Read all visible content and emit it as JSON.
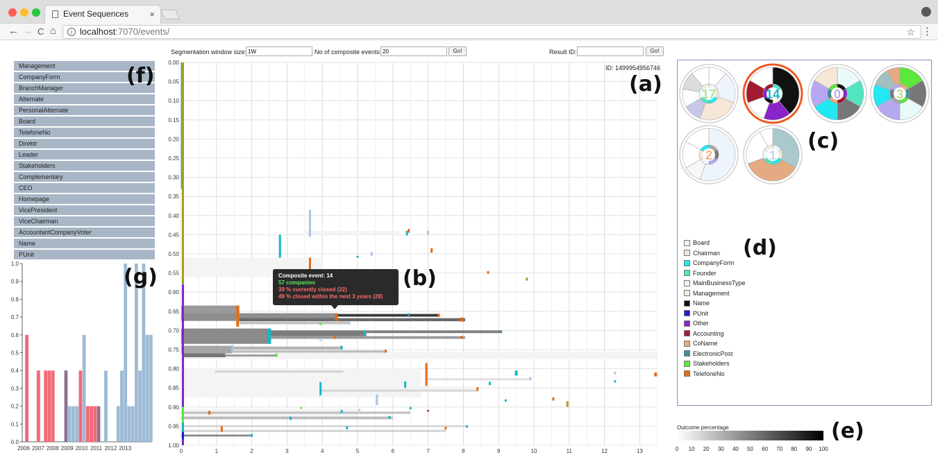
{
  "browser": {
    "tab_title": "Event Sequences",
    "tab_close": "×",
    "url": "localhost:7070/events/",
    "url_host": "localhost",
    "url_path": ":7070/events/",
    "nav_back": "←",
    "nav_forward": "→",
    "nav_reload": "C",
    "nav_home": "⌂",
    "info_glyph": "i",
    "star_glyph": "☆",
    "menu_glyph": "⋮"
  },
  "controls": {
    "window_label": "Segmentation window size:",
    "window_value": "1W",
    "composite_label": "No of composite events:",
    "composite_value": "20",
    "go_label": "Go!",
    "result_label": "Result ID:",
    "result_value": "",
    "result_go_label": "Go!"
  },
  "attributes": [
    "Management",
    "CompanyForm",
    "BranchManager",
    "Alternate",
    "PersonalAlternate",
    "Board",
    "TelefoneNo",
    "Direktr",
    "Leader",
    "Stakeholders",
    "Complementary",
    "CEO",
    "Homepage",
    "VicePresident",
    "ViceChairman",
    "AccountantCompanyVoter",
    "Name",
    "PUnit"
  ],
  "panel_labels": {
    "a": "(a)",
    "b": "(b)",
    "c": "(c)",
    "d": "(d)",
    "e": "(e)",
    "f": "(f)",
    "g": "(g)"
  },
  "main_chart": {
    "id_label": "ID: 1499954956746",
    "y_ticks": [
      "0.00",
      "0.05",
      "0.10",
      "0.15",
      "0.20",
      "0.25",
      "0.30",
      "0.35",
      "0.40",
      "0.45",
      "0.50",
      "0.55",
      "0.60",
      "0.65",
      "0.70",
      "0.75",
      "0.80",
      "0.85",
      "0.90",
      "0.95",
      "1.00"
    ],
    "x_ticks": [
      "0",
      "1",
      "2",
      "3",
      "4",
      "5",
      "6",
      "7",
      "8",
      "9",
      "10",
      "11",
      "12",
      "13"
    ]
  },
  "tooltip": {
    "title": "Composite event: 14",
    "companies": "57 companies",
    "closed": "39 % currently closed (22)",
    "within": "49 % closed within the next 3 years (28)"
  },
  "glyphs": [
    {
      "label": "17",
      "selected": false,
      "color": "#a7e5a2"
    },
    {
      "label": "14",
      "selected": true,
      "color": "#18b9c9"
    },
    {
      "label": "0",
      "selected": false,
      "color": "#c4a9e6"
    },
    {
      "label": "3",
      "selected": false,
      "color": "#c7dc8d"
    },
    {
      "label": "2",
      "selected": false,
      "color": "#f2b684"
    },
    {
      "label": "1",
      "selected": false,
      "color": "#c9d4e8"
    }
  ],
  "legend": [
    {
      "label": "Board",
      "color": "#eef4fb"
    },
    {
      "label": "Chairman",
      "color": "#f6e6d6"
    },
    {
      "label": "CompanyForm",
      "color": "#21e8f3"
    },
    {
      "label": "Founder",
      "color": "#52e5c0"
    },
    {
      "label": "MainBusinessType",
      "color": "#e9fafa"
    },
    {
      "label": "Management",
      "color": "#f0eedd"
    },
    {
      "label": "Name",
      "color": "#111111"
    },
    {
      "label": "PUnit",
      "color": "#1b1bd8"
    },
    {
      "label": "Other",
      "color": "#8a23c9"
    },
    {
      "label": "Accounting",
      "color": "#a3192f"
    },
    {
      "label": "CoName",
      "color": "#e3aa83"
    },
    {
      "label": "ElectronicPost",
      "color": "#3f8f98"
    },
    {
      "label": "Stakeholders",
      "color": "#5ce83a"
    },
    {
      "label": "TelefoneNo",
      "color": "#e86a14"
    }
  ],
  "outcome": {
    "title": "Outcome percentage",
    "ticks": [
      "0",
      "10",
      "20",
      "30",
      "40",
      "50",
      "60",
      "70",
      "80",
      "90",
      "100"
    ]
  },
  "chart_data": {
    "type": "bar",
    "categories": [
      "2006",
      "2007",
      "2008",
      "2009",
      "2010",
      "2011",
      "2012",
      "2013"
    ],
    "y_ticks": [
      "0.0",
      "0.1",
      "0.2",
      "0.3",
      "0.4",
      "0.5",
      "0.6",
      "0.7",
      "0.8",
      "0.9",
      "1.0"
    ],
    "ylim": [
      0,
      1
    ],
    "bars": [
      {
        "pos": 0.2,
        "value": 0.6,
        "color": "#f26a78"
      },
      {
        "pos": 1.0,
        "value": 0.4,
        "color": "#f26a78"
      },
      {
        "pos": 1.5,
        "value": 0.4,
        "color": "#f26a78"
      },
      {
        "pos": 1.75,
        "value": 0.4,
        "color": "#f26a78"
      },
      {
        "pos": 2.0,
        "value": 0.4,
        "color": "#f26a78"
      },
      {
        "pos": 2.9,
        "value": 0.4,
        "color": "#8e708f"
      },
      {
        "pos": 3.15,
        "value": 0.2,
        "color": "#9dbad6"
      },
      {
        "pos": 3.4,
        "value": 0.2,
        "color": "#9dbad6"
      },
      {
        "pos": 3.65,
        "value": 0.2,
        "color": "#9dbad6"
      },
      {
        "pos": 3.9,
        "value": 0.4,
        "color": "#f26a78"
      },
      {
        "pos": 4.15,
        "value": 0.6,
        "color": "#9dbad6"
      },
      {
        "pos": 4.4,
        "value": 0.2,
        "color": "#f26a78"
      },
      {
        "pos": 4.65,
        "value": 0.2,
        "color": "#f26a78"
      },
      {
        "pos": 4.9,
        "value": 0.2,
        "color": "#f26a78"
      },
      {
        "pos": 5.15,
        "value": 0.2,
        "color": "#8e708f"
      },
      {
        "pos": 5.65,
        "value": 0.4,
        "color": "#9dbad6"
      },
      {
        "pos": 6.5,
        "value": 0.2,
        "color": "#9dbad6"
      },
      {
        "pos": 6.75,
        "value": 0.4,
        "color": "#9dbad6"
      },
      {
        "pos": 7.0,
        "value": 1.0,
        "color": "#9dbad6"
      },
      {
        "pos": 7.25,
        "value": 0.2,
        "color": "#9dbad6"
      },
      {
        "pos": 7.5,
        "value": 0.2,
        "color": "#9dbad6"
      },
      {
        "pos": 7.75,
        "value": 1.0,
        "color": "#9dbad6"
      },
      {
        "pos": 8.0,
        "value": 0.4,
        "color": "#9dbad6"
      },
      {
        "pos": 8.25,
        "value": 1.0,
        "color": "#9dbad6"
      },
      {
        "pos": 8.5,
        "value": 0.6,
        "color": "#9dbad6"
      },
      {
        "pos": 8.75,
        "value": 0.6,
        "color": "#9dbad6"
      }
    ]
  }
}
